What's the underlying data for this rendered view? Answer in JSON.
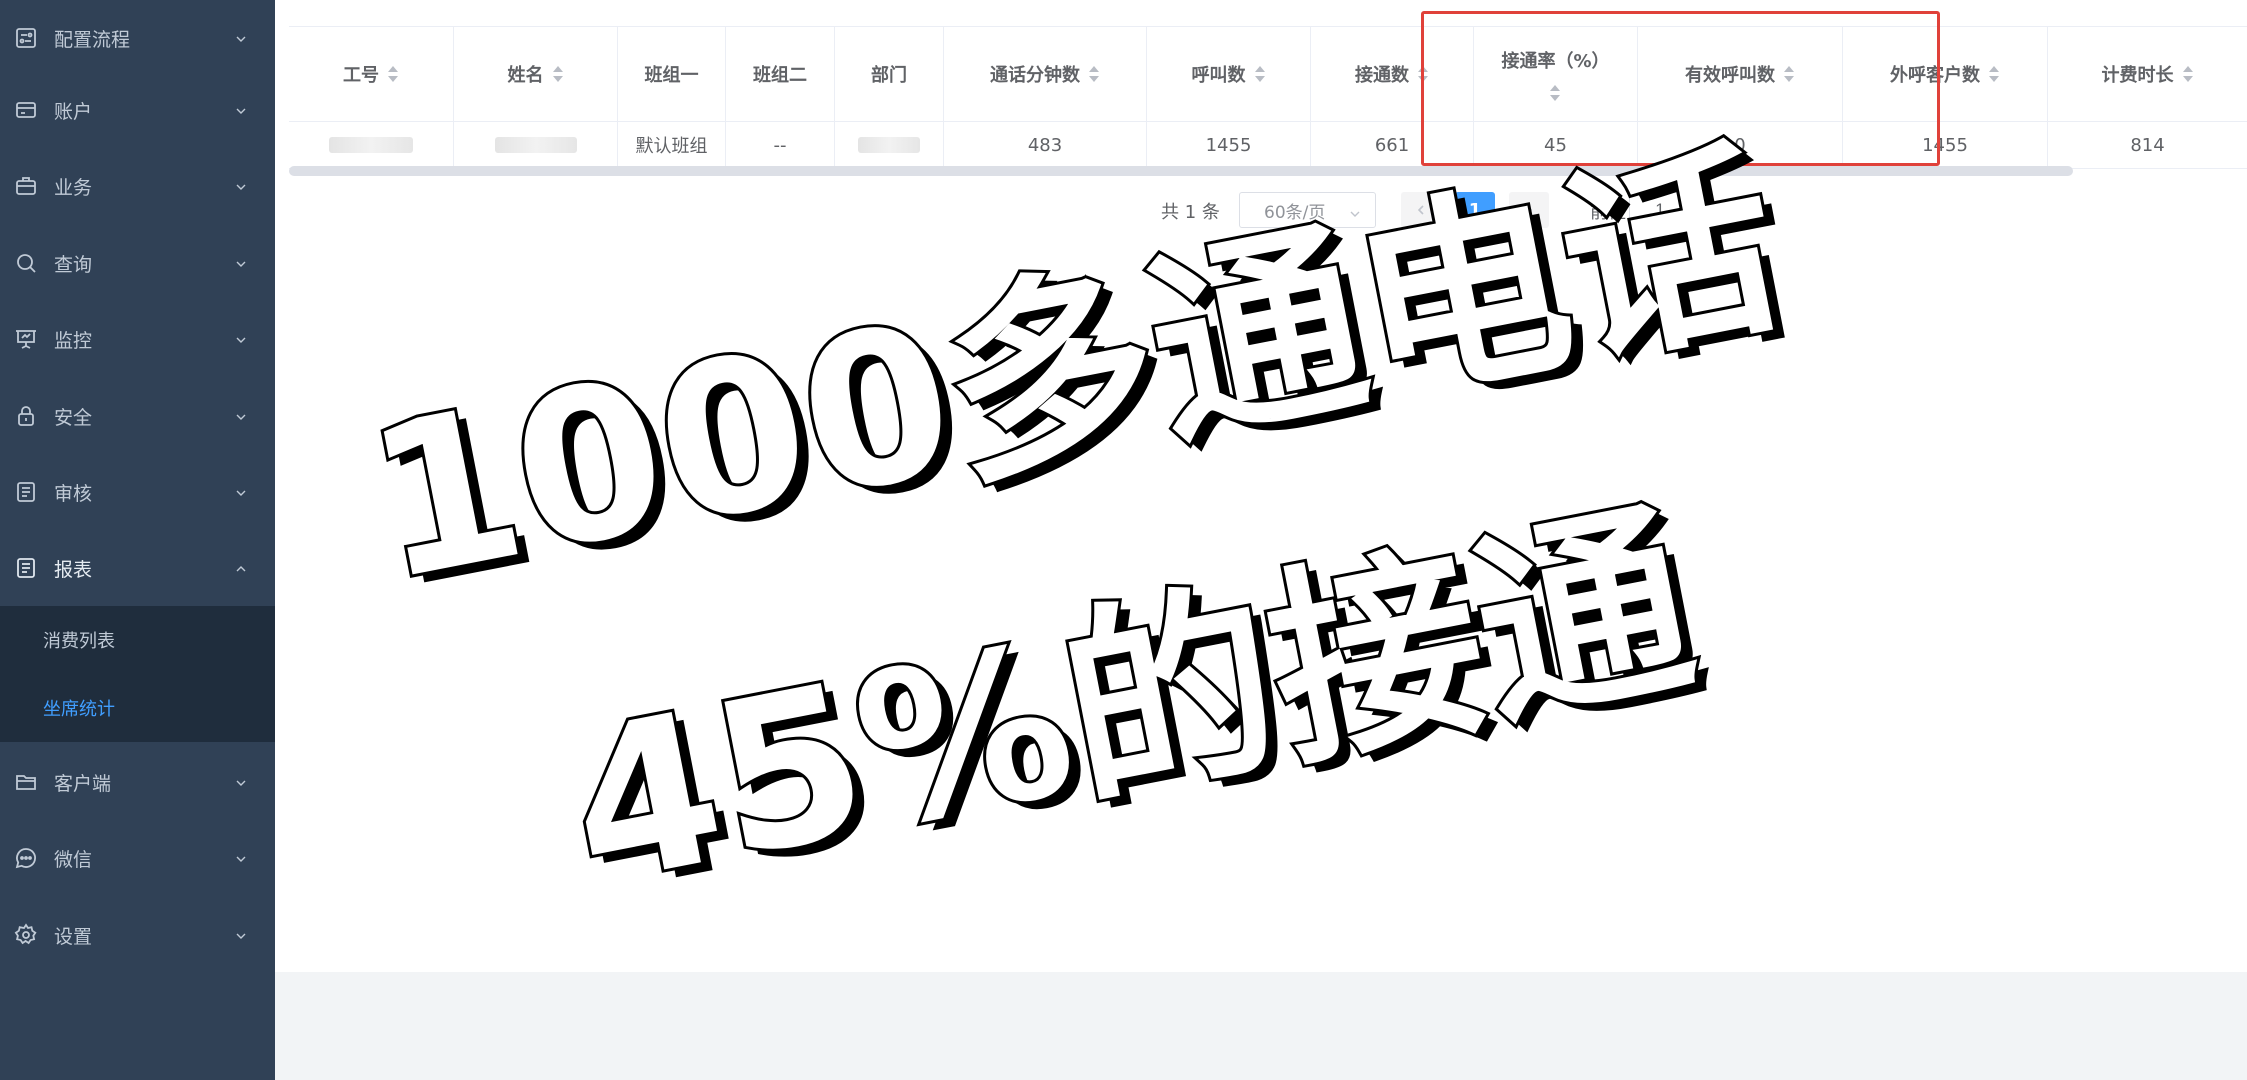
{
  "sidebar": {
    "items": [
      {
        "label": "配置流程",
        "icon": "flow-icon"
      },
      {
        "label": "账户",
        "icon": "card-icon"
      },
      {
        "label": "业务",
        "icon": "briefcase-icon"
      },
      {
        "label": "查询",
        "icon": "search-icon"
      },
      {
        "label": "监控",
        "icon": "monitor-icon"
      },
      {
        "label": "安全",
        "icon": "lock-icon"
      },
      {
        "label": "审核",
        "icon": "document-icon"
      },
      {
        "label": "报表",
        "icon": "report-icon"
      },
      {
        "label": "客户端",
        "icon": "folder-icon"
      },
      {
        "label": "微信",
        "icon": "chat-icon"
      },
      {
        "label": "设置",
        "icon": "gear-icon"
      }
    ],
    "submenu": [
      {
        "label": "消费列表",
        "active": false
      },
      {
        "label": "坐席统计",
        "active": true
      }
    ]
  },
  "table": {
    "headers": [
      "工号",
      "姓名",
      "班组一",
      "班组二",
      "部门",
      "通话分钟数",
      "呼叫数",
      "接通数",
      "接通率（%）",
      "有效呼叫数",
      "外呼客户数",
      "计费时长"
    ],
    "rows": [
      [
        "",
        "",
        "默认班组",
        "--",
        "",
        "483",
        "1455",
        "661",
        "45",
        "0",
        "1455",
        "814"
      ]
    ]
  },
  "pagination": {
    "total": "共 1 条",
    "page_size": "60条/页",
    "current_page": "1",
    "goto_label": "前往",
    "goto_value": "1",
    "page_unit": "页"
  },
  "caption": {
    "line1": "1000多通电话",
    "line2": "45%的接通"
  },
  "colors": {
    "sidebar_bg": "#304156",
    "submenu_bg": "#1f2d3d",
    "accent": "#409eff",
    "highlight_box": "#e0413a"
  }
}
